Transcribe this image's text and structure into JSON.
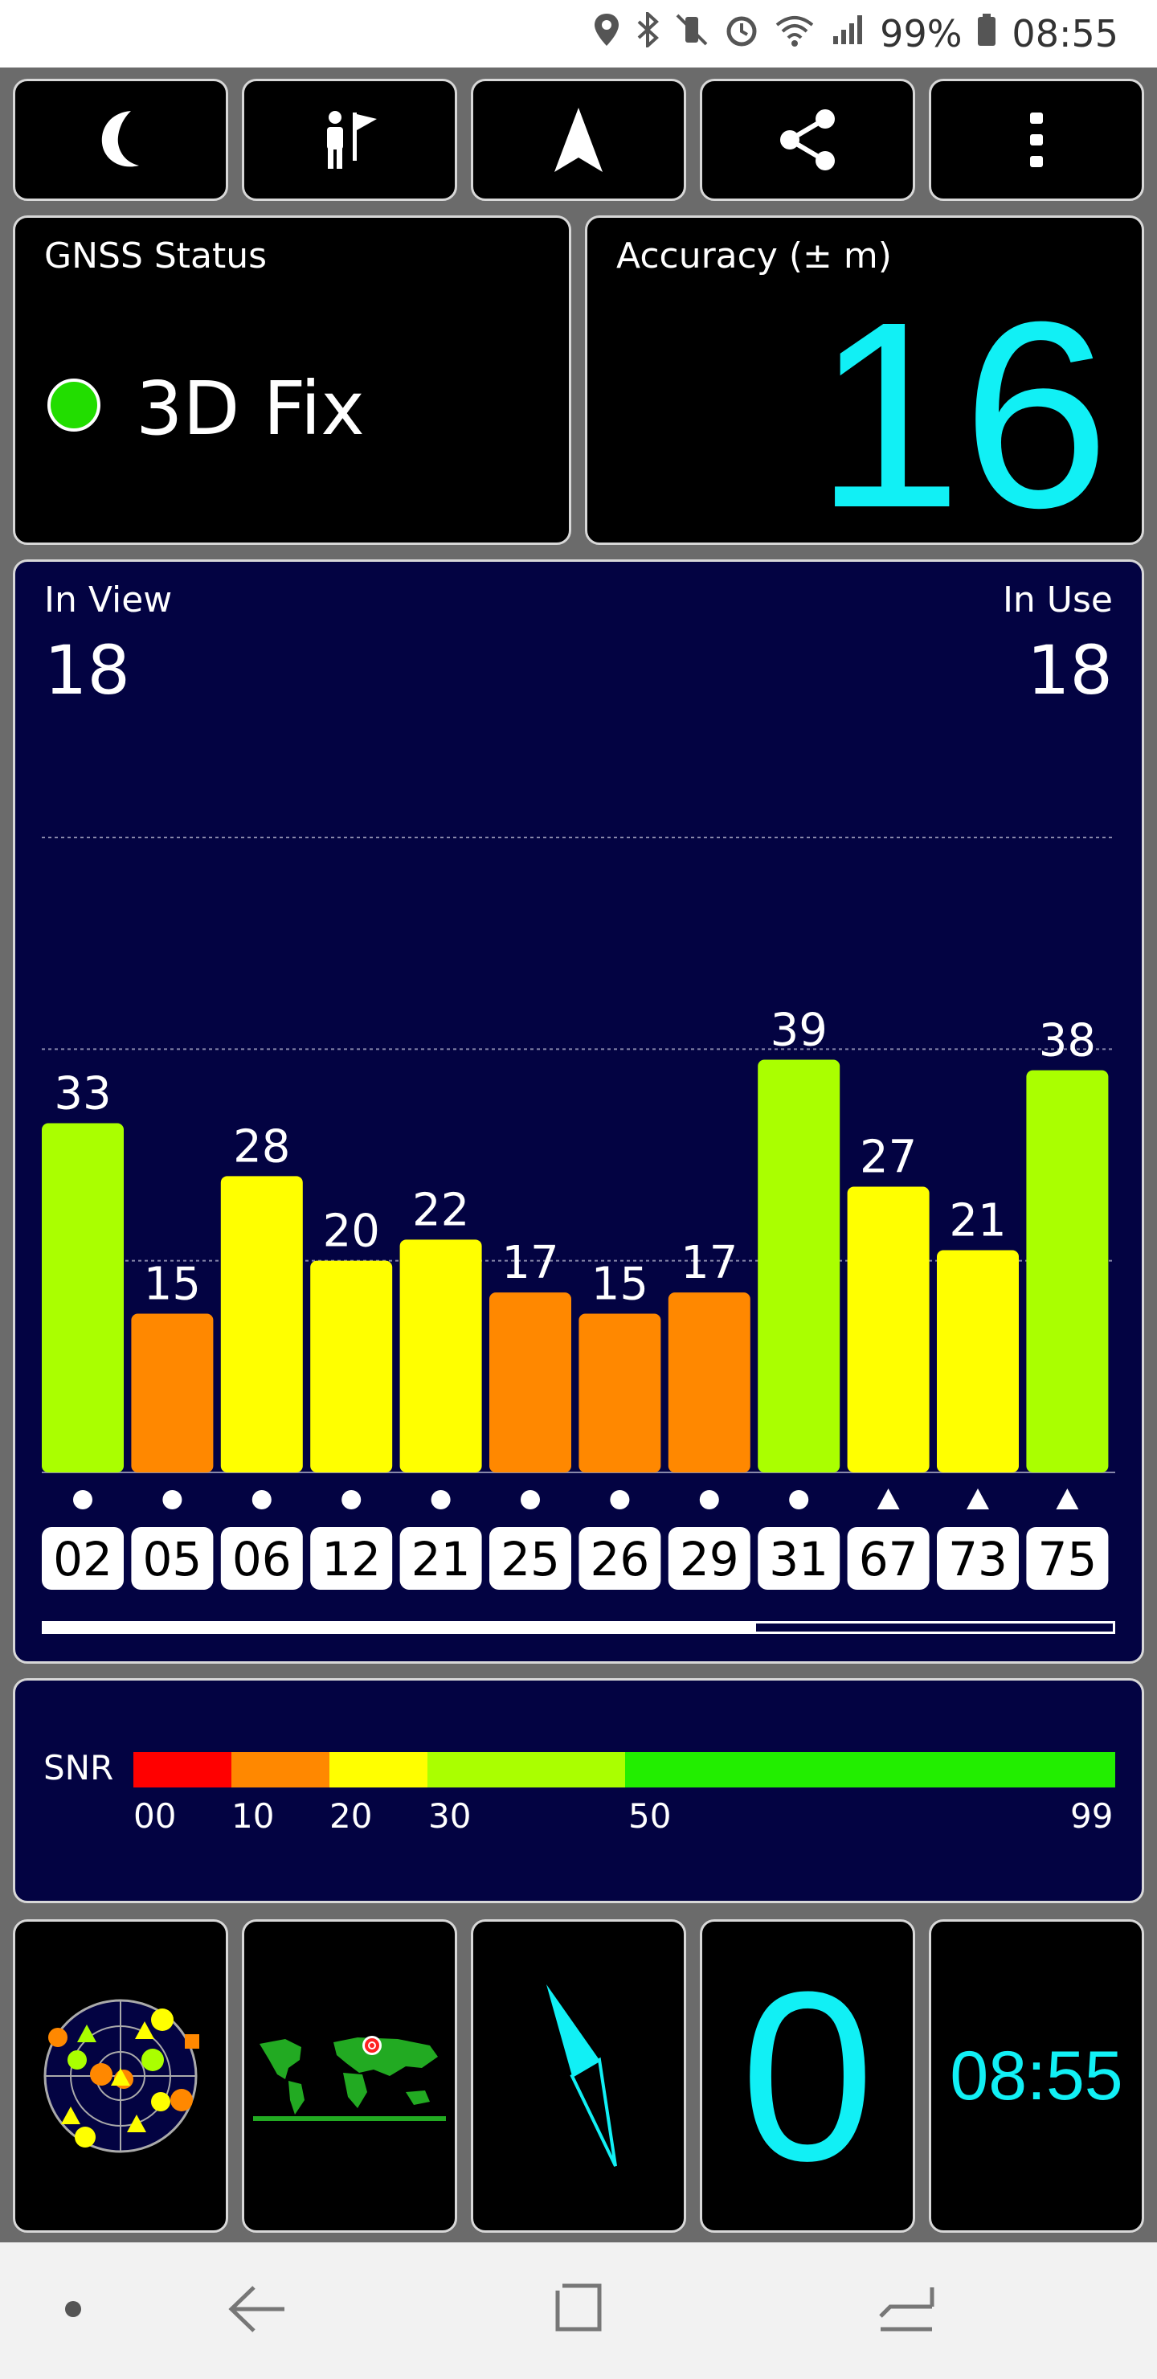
{
  "status_bar": {
    "battery": "99%",
    "time": "08:55",
    "icons": [
      "location-icon",
      "bluetooth-icon",
      "vibrate-icon",
      "alarm-icon",
      "wifi-icon",
      "signal-icon",
      "battery-icon"
    ]
  },
  "toolbar": {
    "buttons": [
      "night-mode-icon",
      "pedestrian-icon",
      "navigation-arrow-icon",
      "share-icon",
      "more-vertical-icon"
    ]
  },
  "gnss": {
    "label": "GNSS Status",
    "fix": "3D Fix",
    "fix_color": "#22dd00"
  },
  "accuracy": {
    "label": "Accuracy (± m)",
    "value": "16",
    "color": "#11f0f5"
  },
  "satellites": {
    "in_view_label": "In View",
    "in_view": "18",
    "in_use_label": "In Use",
    "in_use": "18"
  },
  "chart_data": {
    "type": "bar",
    "categories": [
      "02",
      "05",
      "06",
      "12",
      "21",
      "25",
      "26",
      "29",
      "31",
      "67",
      "73",
      "75"
    ],
    "values": [
      33,
      15,
      28,
      20,
      22,
      17,
      15,
      17,
      39,
      27,
      21,
      38
    ],
    "markers": [
      "dot",
      "dot",
      "dot",
      "dot",
      "dot",
      "dot",
      "dot",
      "dot",
      "dot",
      "triangle",
      "triangle",
      "triangle"
    ],
    "ylim": [
      0,
      60
    ],
    "grid": true
  },
  "snr_scale": {
    "label": "SNR",
    "ticks": [
      "00",
      "10",
      "20",
      "30",
      "50",
      "99"
    ],
    "colors": [
      "#ff0000",
      "#ff8800",
      "#ffff00",
      "#aaff00",
      "#22ee00"
    ]
  },
  "bottom": {
    "radar_icon": "sky-plot-icon",
    "map_icon": "world-map-icon",
    "compass_icon": "compass-icon",
    "speed": "0",
    "time": "08:55",
    "accent": "#11f0f5"
  },
  "nav": {
    "icons": [
      "dot-icon",
      "back-icon",
      "home-icon",
      "recents-icon"
    ]
  }
}
